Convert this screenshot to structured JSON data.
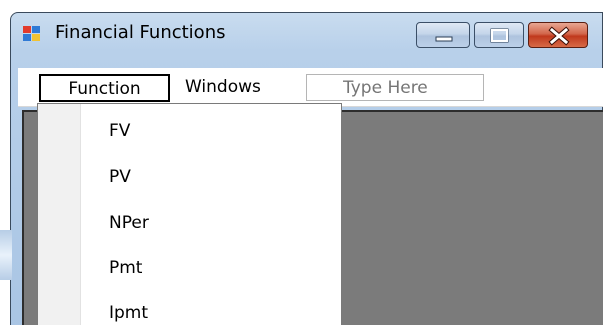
{
  "window": {
    "title": "Financial Functions"
  },
  "menubar": {
    "function_label": "Function",
    "windows_label": "Windows",
    "textbox_placeholder": "Type Here"
  },
  "dropdown": {
    "items": [
      {
        "label": "FV"
      },
      {
        "label": "PV"
      },
      {
        "label": "NPer"
      },
      {
        "label": "Pmt"
      },
      {
        "label": "Ipmt"
      }
    ]
  },
  "icons": {
    "app": "app-window-icon",
    "minimize": "minimize-icon",
    "maximize": "maximize-icon",
    "close": "close-icon"
  },
  "colors": {
    "client_background": "#7b7b7b",
    "close_button": "#c0391d",
    "frame": "#b8d0ea"
  }
}
